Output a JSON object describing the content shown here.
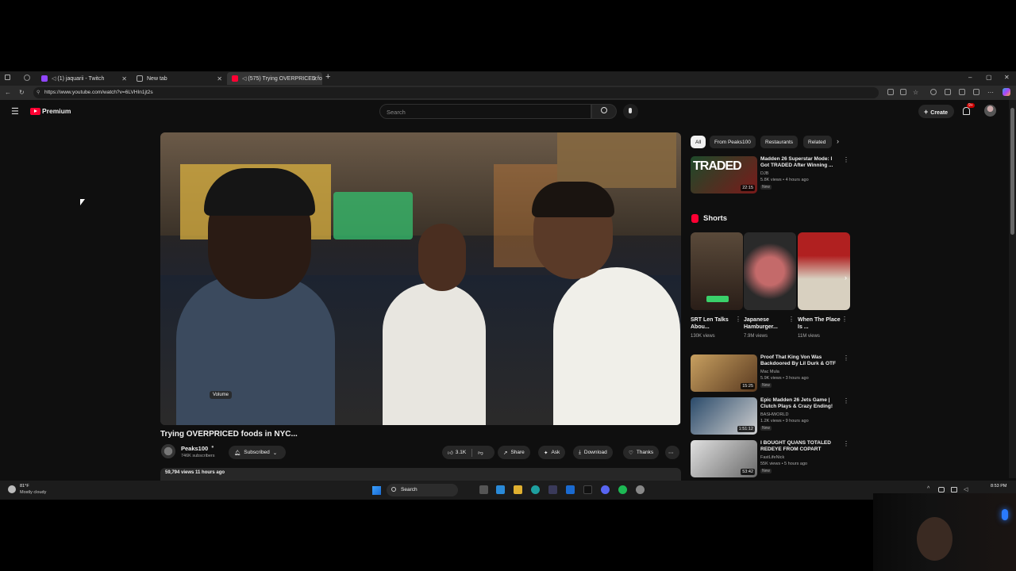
{
  "browser": {
    "tabs": [
      {
        "label": "(1) jaquarii - Twitch",
        "active": false
      },
      {
        "label": "New tab",
        "active": false
      },
      {
        "label": "(575) Trying OVERPRICED fo",
        "active": true
      }
    ],
    "url": "https://www.youtube.com/watch?v=6LVHIn1jt2s"
  },
  "youtube": {
    "logo_text": "Premium",
    "search_placeholder": "Search",
    "create_label": "Create",
    "notification_count": "9+"
  },
  "video": {
    "title": "Trying OVERPRICED foods in NYC...",
    "volume_tooltip": "Volume",
    "channel_name": "Peaks100",
    "subscribers": "746K subscribers",
    "subscribed_label": "Subscribed",
    "likes": "3.1K",
    "share_label": "Share",
    "ask_label": "Ask",
    "download_label": "Download",
    "thanks_label": "Thanks",
    "views_line": "59,794 views  11 hours ago"
  },
  "sidebar": {
    "chips": [
      "All",
      "From Peaks100",
      "Restaurants",
      "Related"
    ],
    "top_video": {
      "title": "Madden 26 Superstar Mode: I Got TRADED After Winning ...",
      "channel": "DJB",
      "meta": "5.8K views • 4 hours ago",
      "badge": "New",
      "duration": "22:15",
      "thumb_text": "TRADED"
    },
    "shorts_heading": "Shorts",
    "shorts": [
      {
        "title": "SRT Len Talks Abou...",
        "views": "130K views"
      },
      {
        "title": "Japanese Hamburger...",
        "views": "7.9M views"
      },
      {
        "title": "When The Place Is ...",
        "views": "11M views"
      }
    ],
    "videos": [
      {
        "title": "Proof That King Von Was Backdoored By Lil Durk & OTF",
        "channel": "Mac Mula",
        "meta": "5.9K views • 3 hours ago",
        "badge": "New",
        "duration": "15:25"
      },
      {
        "title": "Epic Madden 26 Jets Game | Clutch Plays & Crazy Ending!",
        "channel": "BASHWORLD",
        "meta": "1.2K views • 9 hours ago",
        "badge": "New",
        "duration": "1:51:12"
      },
      {
        "title": "I BOUGHT QUANS TOTALED REDEYE FROM COPART",
        "channel": "FastLifeNick",
        "meta": "55K views • 5 hours ago",
        "badge": "New",
        "duration": "53:42"
      }
    ]
  },
  "taskbar": {
    "weather_temp": "81°F",
    "weather_desc": "Mostly cloudy",
    "search_label": "Search",
    "clock": "8:53 PM"
  },
  "colors": {
    "accent_red": "#ff0033",
    "background": "#0f0f0f"
  }
}
